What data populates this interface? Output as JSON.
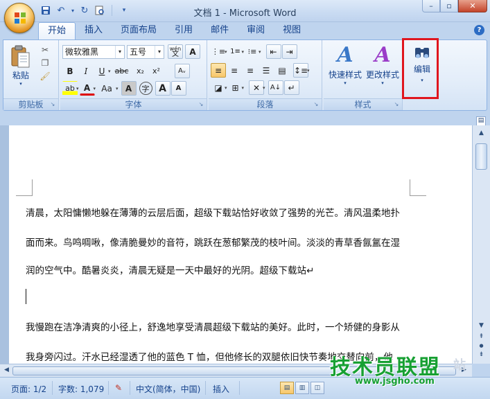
{
  "window": {
    "title": "文档 1 - Microsoft Word",
    "controls": {
      "minimize": "–",
      "restore": "▫",
      "close": "✕"
    }
  },
  "quick_access": {
    "icons": [
      "save-icon",
      "undo-icon",
      "redo-icon",
      "print-preview-icon",
      "customize-icon"
    ]
  },
  "tabs": [
    {
      "label": "开始",
      "active": true
    },
    {
      "label": "插入"
    },
    {
      "label": "页面布局"
    },
    {
      "label": "引用"
    },
    {
      "label": "邮件"
    },
    {
      "label": "审阅"
    },
    {
      "label": "视图"
    }
  ],
  "ribbon": {
    "clipboard": {
      "label": "剪贴板",
      "paste_label": "粘贴"
    },
    "font": {
      "label": "字体",
      "font_name": "微软雅黑",
      "font_size": "五号",
      "wen_label": "wén",
      "buttons": {
        "bold": "B",
        "italic": "I",
        "underline": "U",
        "strike": "abc",
        "subscript": "x₂",
        "superscript": "x²",
        "font_color": "A",
        "change_case": "Aa",
        "char_shading": "A",
        "enclose": "字",
        "grow": "A",
        "shrink": "A"
      }
    },
    "paragraph": {
      "label": "段落"
    },
    "styles": {
      "label": "样式",
      "quick_styles": "快速样式",
      "change_styles": "更改样式"
    },
    "editing": {
      "label": "编辑"
    }
  },
  "document": {
    "paragraphs": [
      "清晨，太阳慵懒地躲在薄薄的云层后面，超级下载站恰好收敛了强势的光芒。清风温柔地扑",
      "面而来。鸟鸣啁啾，像清脆曼妙的音符，跳跃在葱郁繁茂的枝叶间。淡淡的青草香氤氲在湿",
      "润的空气中。酷暑炎炎，清晨无疑是一天中最好的光阴。超级下载站↵",
      "我慢跑在洁净清爽的小径上，舒逸地享受清晨超级下载站的美好。此时，一个矫健的身影从",
      "我身旁闪过。汗水已经湿透了他的蓝色 T 恤，但他修长的双腿依旧快节奏地交替向前，他"
    ]
  },
  "status": {
    "page": "页面: 1/2",
    "words": "字数: 1,079",
    "language": "中文(简体，中国)",
    "mode": "插入"
  },
  "watermark": {
    "text": "技术员联盟",
    "url": "www.jsgho.com",
    "suffix": "站"
  },
  "colors": {
    "highlight_box": "#e0161e",
    "watermark": "#17a033",
    "ribbon_text": "#15428b"
  }
}
